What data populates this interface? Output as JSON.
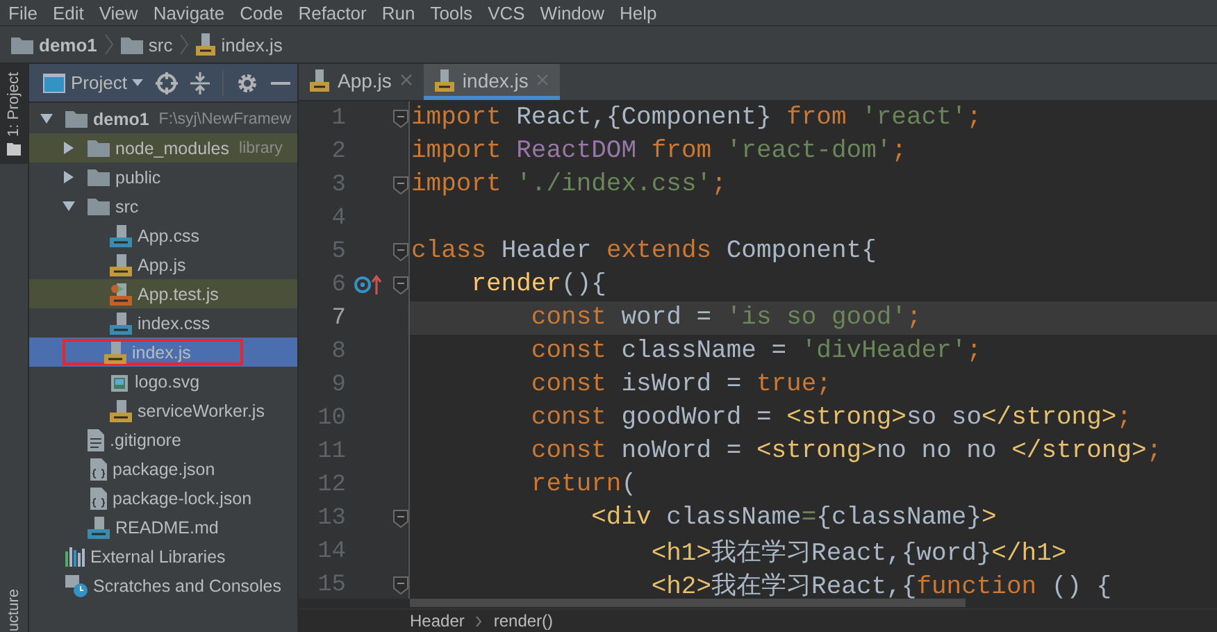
{
  "menu": [
    "File",
    "Edit",
    "View",
    "Navigate",
    "Code",
    "Refactor",
    "Run",
    "Tools",
    "VCS",
    "Window",
    "Help"
  ],
  "breadcrumb": [
    {
      "kind": "folder",
      "label": "demo1"
    },
    {
      "kind": "folder",
      "label": "src"
    },
    {
      "kind": "js",
      "label": "index.js"
    }
  ],
  "side_stripe": {
    "top": "1: Project",
    "bottom": "ucture"
  },
  "project_panel": {
    "title": "Project",
    "tree": [
      {
        "kind": "folder",
        "label": "demo1",
        "detail": "F:\\syj\\NewFramew",
        "expanded": true,
        "selected": false,
        "highlighted": false,
        "boxed": false,
        "children": [
          {
            "kind": "folder",
            "label": "node_modules",
            "detail": "library",
            "expanded": false,
            "selected": false,
            "highlighted": true,
            "boxed": false
          },
          {
            "kind": "folder",
            "label": "public",
            "expanded": false,
            "selected": false,
            "highlighted": false,
            "boxed": false
          },
          {
            "kind": "folder",
            "label": "src",
            "expanded": true,
            "selected": false,
            "highlighted": false,
            "boxed": false,
            "children": [
              {
                "kind": "css",
                "label": "App.css",
                "selected": false,
                "highlighted": false,
                "boxed": false
              },
              {
                "kind": "js",
                "label": "App.js",
                "selected": false,
                "highlighted": false,
                "boxed": false
              },
              {
                "kind": "test",
                "label": "App.test.js",
                "selected": false,
                "highlighted": true,
                "boxed": false
              },
              {
                "kind": "css",
                "label": "index.css",
                "selected": false,
                "highlighted": false,
                "boxed": false
              },
              {
                "kind": "js",
                "label": "index.js",
                "selected": true,
                "highlighted": false,
                "boxed": true
              },
              {
                "kind": "svg",
                "label": "logo.svg",
                "selected": false,
                "highlighted": false,
                "boxed": false
              },
              {
                "kind": "js",
                "label": "serviceWorker.js",
                "selected": false,
                "highlighted": false,
                "boxed": false
              }
            ]
          },
          {
            "kind": "text",
            "label": ".gitignore",
            "selected": false,
            "highlighted": false,
            "boxed": false
          },
          {
            "kind": "json",
            "label": "package.json",
            "selected": false,
            "highlighted": false,
            "boxed": false
          },
          {
            "kind": "json",
            "label": "package-lock.json",
            "selected": false,
            "highlighted": false,
            "boxed": false
          },
          {
            "kind": "md",
            "label": "README.md",
            "selected": false,
            "highlighted": false,
            "boxed": false
          }
        ]
      },
      {
        "kind": "libraries",
        "label": "External Libraries",
        "selected": false,
        "highlighted": false,
        "boxed": false
      },
      {
        "kind": "scratches",
        "label": "Scratches and Consoles",
        "selected": false,
        "highlighted": false,
        "boxed": false
      }
    ]
  },
  "tabs": [
    {
      "label": "App.js",
      "selected": false
    },
    {
      "label": "index.js",
      "selected": true
    }
  ],
  "code": [
    {
      "number": "1",
      "current": false,
      "fold": true,
      "override": false,
      "tokens": [
        {
          "kind": "kw",
          "text": "import "
        },
        {
          "kind": "plain",
          "text": "React,{Component} "
        },
        {
          "kind": "kw",
          "text": "from "
        },
        {
          "kind": "str",
          "text": "'react'"
        },
        {
          "kind": "kw",
          "text": ";"
        }
      ]
    },
    {
      "number": "2",
      "current": false,
      "fold": false,
      "override": false,
      "tokens": [
        {
          "kind": "kw",
          "text": "import "
        },
        {
          "kind": "cls",
          "text": "ReactDOM "
        },
        {
          "kind": "kw",
          "text": "from "
        },
        {
          "kind": "str",
          "text": "'react-dom'"
        },
        {
          "kind": "kw",
          "text": ";"
        }
      ]
    },
    {
      "number": "3",
      "current": false,
      "fold": true,
      "override": false,
      "tokens": [
        {
          "kind": "kw",
          "text": "import "
        },
        {
          "kind": "str",
          "text": "'./index.css'"
        },
        {
          "kind": "kw",
          "text": ";"
        }
      ]
    },
    {
      "number": "4",
      "current": false,
      "fold": false,
      "override": false
    },
    {
      "number": "5",
      "current": false,
      "fold": true,
      "override": false,
      "tokens": [
        {
          "kind": "kw",
          "text": "class "
        },
        {
          "kind": "plain",
          "text": "Header "
        },
        {
          "kind": "kw",
          "text": "extends "
        },
        {
          "kind": "plain",
          "text": "Component{"
        }
      ]
    },
    {
      "number": "6",
      "current": false,
      "fold": true,
      "override": true,
      "tokens": [
        {
          "kind": "fn",
          "text": "    render"
        },
        {
          "kind": "plain",
          "text": "(){"
        }
      ]
    },
    {
      "number": "7",
      "current": true,
      "fold": false,
      "override": false,
      "tokens": [
        {
          "kind": "kw",
          "text": "        const "
        },
        {
          "kind": "plain",
          "text": "word = "
        },
        {
          "kind": "str",
          "text": "'is so good'"
        },
        {
          "kind": "kw",
          "text": ";"
        }
      ]
    },
    {
      "number": "8",
      "current": false,
      "fold": false,
      "override": false,
      "tokens": [
        {
          "kind": "kw",
          "text": "        const "
        },
        {
          "kind": "plain",
          "text": "className = "
        },
        {
          "kind": "str",
          "text": "'divHeader'"
        },
        {
          "kind": "kw",
          "text": ";"
        }
      ]
    },
    {
      "number": "9",
      "current": false,
      "fold": false,
      "override": false,
      "tokens": [
        {
          "kind": "kw",
          "text": "        const "
        },
        {
          "kind": "plain",
          "text": "isWord = "
        },
        {
          "kind": "kw",
          "text": "true;"
        }
      ]
    },
    {
      "number": "10",
      "current": false,
      "fold": false,
      "override": false,
      "tokens": [
        {
          "kind": "kw",
          "text": "        const "
        },
        {
          "kind": "plain",
          "text": "goodWord = "
        },
        {
          "kind": "tag",
          "text": "<strong>"
        },
        {
          "kind": "plain",
          "text": "so so"
        },
        {
          "kind": "tag",
          "text": "</strong>"
        },
        {
          "kind": "kw",
          "text": ";"
        }
      ]
    },
    {
      "number": "11",
      "current": false,
      "fold": false,
      "override": false,
      "tokens": [
        {
          "kind": "kw",
          "text": "        const "
        },
        {
          "kind": "plain",
          "text": "noWord = "
        },
        {
          "kind": "tag",
          "text": "<strong>"
        },
        {
          "kind": "plain",
          "text": "no no no "
        },
        {
          "kind": "tag",
          "text": "</strong>"
        },
        {
          "kind": "kw",
          "text": ";"
        }
      ]
    },
    {
      "number": "12",
      "current": false,
      "fold": false,
      "override": false,
      "tokens": [
        {
          "kind": "kw",
          "text": "        return"
        },
        {
          "kind": "plain",
          "text": "("
        }
      ]
    },
    {
      "number": "13",
      "current": false,
      "fold": true,
      "override": false,
      "tokens": [
        {
          "kind": "tag",
          "text": "            <div "
        },
        {
          "kind": "plain",
          "text": "className"
        },
        {
          "kind": "str",
          "text": "="
        },
        {
          "kind": "plain",
          "text": "{className}"
        },
        {
          "kind": "tag",
          "text": ">"
        }
      ]
    },
    {
      "number": "14",
      "current": false,
      "fold": false,
      "override": false,
      "tokens": [
        {
          "kind": "tag",
          "text": "                <h1>"
        },
        {
          "kind": "plain",
          "text": "我在学习React,{word}"
        },
        {
          "kind": "tag",
          "text": "</h1>"
        }
      ]
    },
    {
      "number": "15",
      "current": false,
      "fold": true,
      "override": false,
      "tokens": [
        {
          "kind": "tag",
          "text": "                <h2>"
        },
        {
          "kind": "plain",
          "text": "我在学习React,{"
        },
        {
          "kind": "kw",
          "text": "function "
        },
        {
          "kind": "plain",
          "text": "() {"
        }
      ]
    }
  ],
  "status_breadcrumb": [
    "Header",
    "render()"
  ]
}
